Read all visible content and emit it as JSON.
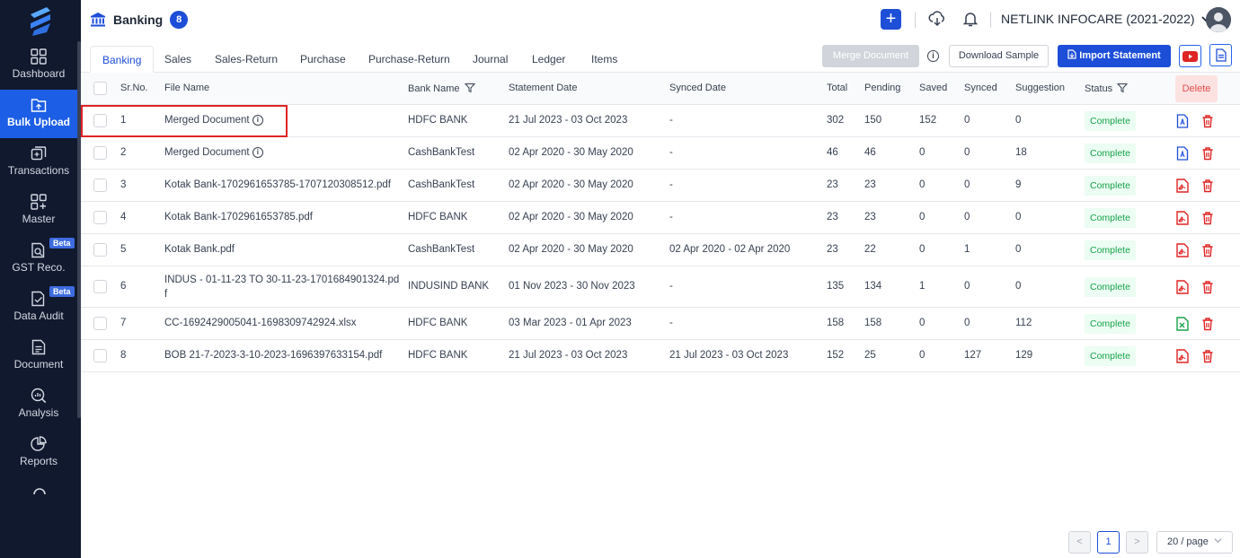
{
  "sidebar": {
    "items": [
      {
        "label": "Dashboard",
        "icon": "dashboard-icon"
      },
      {
        "label": "Bulk Upload",
        "icon": "bulk-upload-icon",
        "active": true
      },
      {
        "label": "Transactions",
        "icon": "transactions-icon"
      },
      {
        "label": "Master",
        "icon": "master-icon"
      },
      {
        "label": "GST Reco.",
        "icon": "gst-reco-icon",
        "badge": "Beta"
      },
      {
        "label": "Data Audit",
        "icon": "data-audit-icon",
        "badge": "Beta"
      },
      {
        "label": "Document",
        "icon": "document-icon"
      },
      {
        "label": "Analysis",
        "icon": "analysis-icon"
      },
      {
        "label": "Reports",
        "icon": "reports-icon"
      }
    ]
  },
  "header": {
    "title": "Banking",
    "count": "8",
    "company": "NETLINK INFOCARE (2021-2022)"
  },
  "tabs": [
    "Banking",
    "Sales",
    "Sales-Return",
    "Purchase",
    "Purchase-Return",
    "Journal",
    "Ledger",
    "Items"
  ],
  "toolbar": {
    "merge": "Merge Document",
    "info": "i",
    "download": "Download Sample",
    "import": "Import Statement"
  },
  "table": {
    "columns": {
      "srno": "Sr.No.",
      "file": "File Name",
      "bank": "Bank Name",
      "statement": "Statement Date",
      "synced_date": "Synced Date",
      "total": "Total",
      "pending": "Pending",
      "saved": "Saved",
      "synced": "Synced",
      "suggestion": "Suggestion",
      "status": "Status",
      "delete": "Delete"
    },
    "rows": [
      {
        "sr": "1",
        "file": "Merged Document",
        "info": "i",
        "bank": "HDFC BANK",
        "statement": "21 Jul 2023 - 03 Oct 2023",
        "synced_date": "-",
        "total": "302",
        "pending": "150",
        "saved": "152",
        "synced": "0",
        "suggestion": "0",
        "status": "Complete",
        "type": "merged"
      },
      {
        "sr": "2",
        "file": "Merged Document",
        "info": "i",
        "bank": "CashBankTest",
        "statement": "02 Apr 2020 - 30 May 2020",
        "synced_date": "-",
        "total": "46",
        "pending": "46",
        "saved": "0",
        "synced": "0",
        "suggestion": "18",
        "status": "Complete",
        "type": "merged"
      },
      {
        "sr": "3",
        "file": "Kotak Bank-1702961653785-1707120308512.pdf",
        "bank": "CashBankTest",
        "statement": "02 Apr 2020 - 30 May 2020",
        "synced_date": "-",
        "total": "23",
        "pending": "23",
        "saved": "0",
        "synced": "0",
        "suggestion": "9",
        "status": "Complete",
        "type": "pdf"
      },
      {
        "sr": "4",
        "file": "Kotak Bank-1702961653785.pdf",
        "bank": "HDFC BANK",
        "statement": "02 Apr 2020 - 30 May 2020",
        "synced_date": "-",
        "total": "23",
        "pending": "23",
        "saved": "0",
        "synced": "0",
        "suggestion": "0",
        "status": "Complete",
        "type": "pdf"
      },
      {
        "sr": "5",
        "file": "Kotak Bank.pdf",
        "bank": "CashBankTest",
        "statement": "02 Apr 2020 - 30 May 2020",
        "synced_date": "02 Apr 2020 - 02 Apr 2020",
        "total": "23",
        "pending": "22",
        "saved": "0",
        "synced": "1",
        "suggestion": "0",
        "status": "Complete",
        "type": "pdf"
      },
      {
        "sr": "6",
        "file": "INDUS - 01-11-23 TO 30-11-23-1701684901324.pdf",
        "bank": "INDUSIND BANK",
        "statement": "01 Nov 2023 - 30 Nov 2023",
        "synced_date": "-",
        "total": "135",
        "pending": "134",
        "saved": "1",
        "synced": "0",
        "suggestion": "0",
        "status": "Complete",
        "type": "pdf"
      },
      {
        "sr": "7",
        "file": "CC-1692429005041-1698309742924.xlsx",
        "bank": "HDFC BANK",
        "statement": "03 Mar 2023 - 01 Apr 2023",
        "synced_date": "-",
        "total": "158",
        "pending": "158",
        "saved": "0",
        "synced": "0",
        "suggestion": "112",
        "status": "Complete",
        "type": "xlsx"
      },
      {
        "sr": "8",
        "file": "BOB 21-7-2023-3-10-2023-1696397633154.pdf",
        "bank": "HDFC BANK",
        "statement": "21 Jul 2023 - 03 Oct 2023",
        "synced_date": "21 Jul 2023 - 03 Oct 2023",
        "total": "152",
        "pending": "25",
        "saved": "0",
        "synced": "127",
        "suggestion": "129",
        "status": "Complete",
        "type": "pdf"
      }
    ]
  },
  "pagination": {
    "prev": "<",
    "current": "1",
    "next": ">",
    "page_size": "20 / page"
  },
  "colors": {
    "sidebar_bg": "#10192e",
    "accent": "#1d4ed8",
    "complete_text": "#16a34a",
    "delete": "#e02424"
  }
}
